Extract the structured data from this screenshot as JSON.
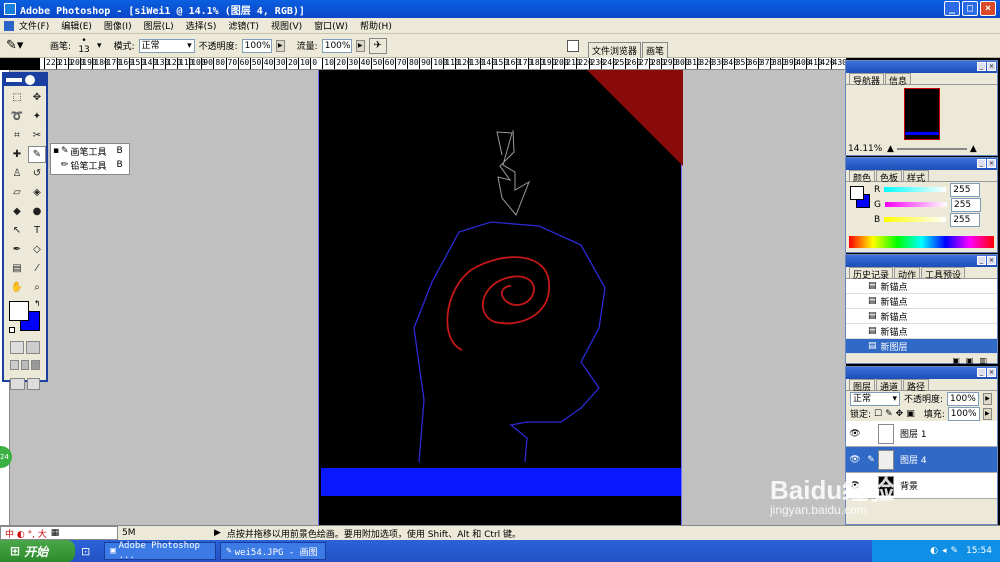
{
  "window": {
    "title": "Adobe Photoshop - [siWei1 @ 14.1% (图层 4, RGB)]"
  },
  "menus": [
    "文件(F)",
    "编辑(E)",
    "图像(I)",
    "图层(L)",
    "选择(S)",
    "滤镜(T)",
    "视图(V)",
    "窗口(W)",
    "帮助(H)"
  ],
  "options": {
    "brush_label": "画笔:",
    "brush_size": "13",
    "mode_label": "模式:",
    "mode_value": "正常",
    "opacity_label": "不透明度:",
    "opacity_value": "100%",
    "flow_label": "流量:",
    "flow_value": "100%"
  },
  "panel_tabs": [
    "文件浏览器",
    "画笔"
  ],
  "ruler_labels": [
    "220",
    "210",
    "200",
    "190",
    "180",
    "170",
    "160",
    "150",
    "140",
    "130",
    "120",
    "110",
    "100",
    "90",
    "80",
    "70",
    "60",
    "50",
    "40",
    "30",
    "20",
    "10",
    "0",
    "10",
    "20",
    "30",
    "40",
    "50",
    "60",
    "70",
    "80",
    "90",
    "100",
    "110",
    "120",
    "130",
    "140",
    "150",
    "160",
    "170",
    "180",
    "190",
    "200",
    "210",
    "220",
    "230",
    "240",
    "250",
    "260",
    "270",
    "280",
    "290",
    "300",
    "310",
    "320",
    "330",
    "340",
    "350",
    "360",
    "370",
    "380",
    "390",
    "400",
    "410",
    "420",
    "430"
  ],
  "flyout": {
    "items": [
      {
        "label": "画笔工具",
        "key": "B"
      },
      {
        "label": "铅笔工具",
        "key": "B"
      }
    ]
  },
  "navigator": {
    "tabs": [
      "导航器",
      "信息"
    ],
    "zoom": "14.11%"
  },
  "color": {
    "tabs": [
      "颜色",
      "色板",
      "样式"
    ],
    "channels": [
      {
        "name": "R",
        "value": "255"
      },
      {
        "name": "G",
        "value": "255"
      },
      {
        "name": "B",
        "value": "255"
      }
    ]
  },
  "history": {
    "tabs": [
      "历史记录",
      "动作",
      "工具预设"
    ],
    "items": [
      "新锚点",
      "新锚点",
      "新锚点",
      "新锚点",
      "新图层"
    ]
  },
  "layers": {
    "tabs": [
      "图层",
      "通道",
      "路径"
    ],
    "mode": "正常",
    "opacity_label": "不透明度:",
    "opacity": "100%",
    "lock_label": "锁定:",
    "fill_label": "填充:",
    "fill": "100%",
    "items": [
      "图层 1",
      "图层 4",
      "背景"
    ]
  },
  "status": {
    "size_text": "5M",
    "hint": "点按并拖移以用前景色绘画。要用附加选项，使用 Shift、Alt 和 Ctrl 键。"
  },
  "ime": {
    "text": "中 ◐ °, 大"
  },
  "badge": "24",
  "taskbar": {
    "start_label": "开始",
    "items": [
      "Adobe Photoshop ...",
      "wei54.JPG - 画图"
    ],
    "time": "15:54"
  },
  "watermark": {
    "brand": "Baidu经验",
    "url": "jingyan.baidu.com"
  }
}
